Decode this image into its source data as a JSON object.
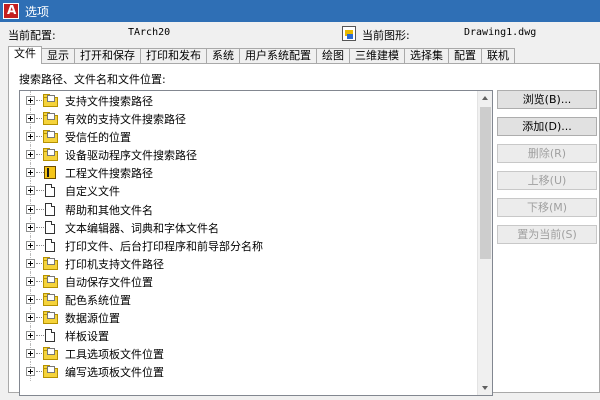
{
  "window": {
    "title": "选项"
  },
  "config": {
    "current_profile_label": "当前配置:",
    "current_profile_value": "TArch20",
    "current_drawing_label": "当前图形:",
    "current_drawing_value": "Drawing1.dwg"
  },
  "tabs": [
    {
      "label": "文件",
      "active": true
    },
    {
      "label": "显示"
    },
    {
      "label": "打开和保存"
    },
    {
      "label": "打印和发布"
    },
    {
      "label": "系统"
    },
    {
      "label": "用户系统配置"
    },
    {
      "label": "绘图"
    },
    {
      "label": "三维建模"
    },
    {
      "label": "选择集"
    },
    {
      "label": "配置"
    },
    {
      "label": "联机"
    }
  ],
  "panel": {
    "section_label": "搜索路径、文件名和文件位置:"
  },
  "tree": {
    "items": [
      {
        "label": "支持文件搜索路径",
        "icon": "folder-icon"
      },
      {
        "label": "有效的支持文件搜索路径",
        "icon": "folder-icon"
      },
      {
        "label": "受信任的位置",
        "icon": "folder-icon"
      },
      {
        "label": "设备驱动程序文件搜索路径",
        "icon": "folder-icon"
      },
      {
        "label": "工程文件搜索路径",
        "icon": "book-icon"
      },
      {
        "label": "自定义文件",
        "icon": "document-icon"
      },
      {
        "label": "帮助和其他文件名",
        "icon": "document-icon"
      },
      {
        "label": "文本编辑器、词典和字体文件名",
        "icon": "document-icon"
      },
      {
        "label": "打印文件、后台打印程序和前导部分名称",
        "icon": "document-icon"
      },
      {
        "label": "打印机支持文件路径",
        "icon": "folder-icon"
      },
      {
        "label": "自动保存文件位置",
        "icon": "folder-icon"
      },
      {
        "label": "配色系统位置",
        "icon": "folder-icon"
      },
      {
        "label": "数据源位置",
        "icon": "folder-icon"
      },
      {
        "label": "样板设置",
        "icon": "document-icon"
      },
      {
        "label": "工具选项板文件位置",
        "icon": "folder-icon"
      },
      {
        "label": "编写选项板文件位置",
        "icon": "folder-icon"
      }
    ]
  },
  "buttons": {
    "browse": "浏览(B)...",
    "add": "添加(D)...",
    "remove": "删除(R)",
    "move_up": "上移(U)",
    "move_down": "下移(M)",
    "set_current": "置为当前(S)"
  }
}
